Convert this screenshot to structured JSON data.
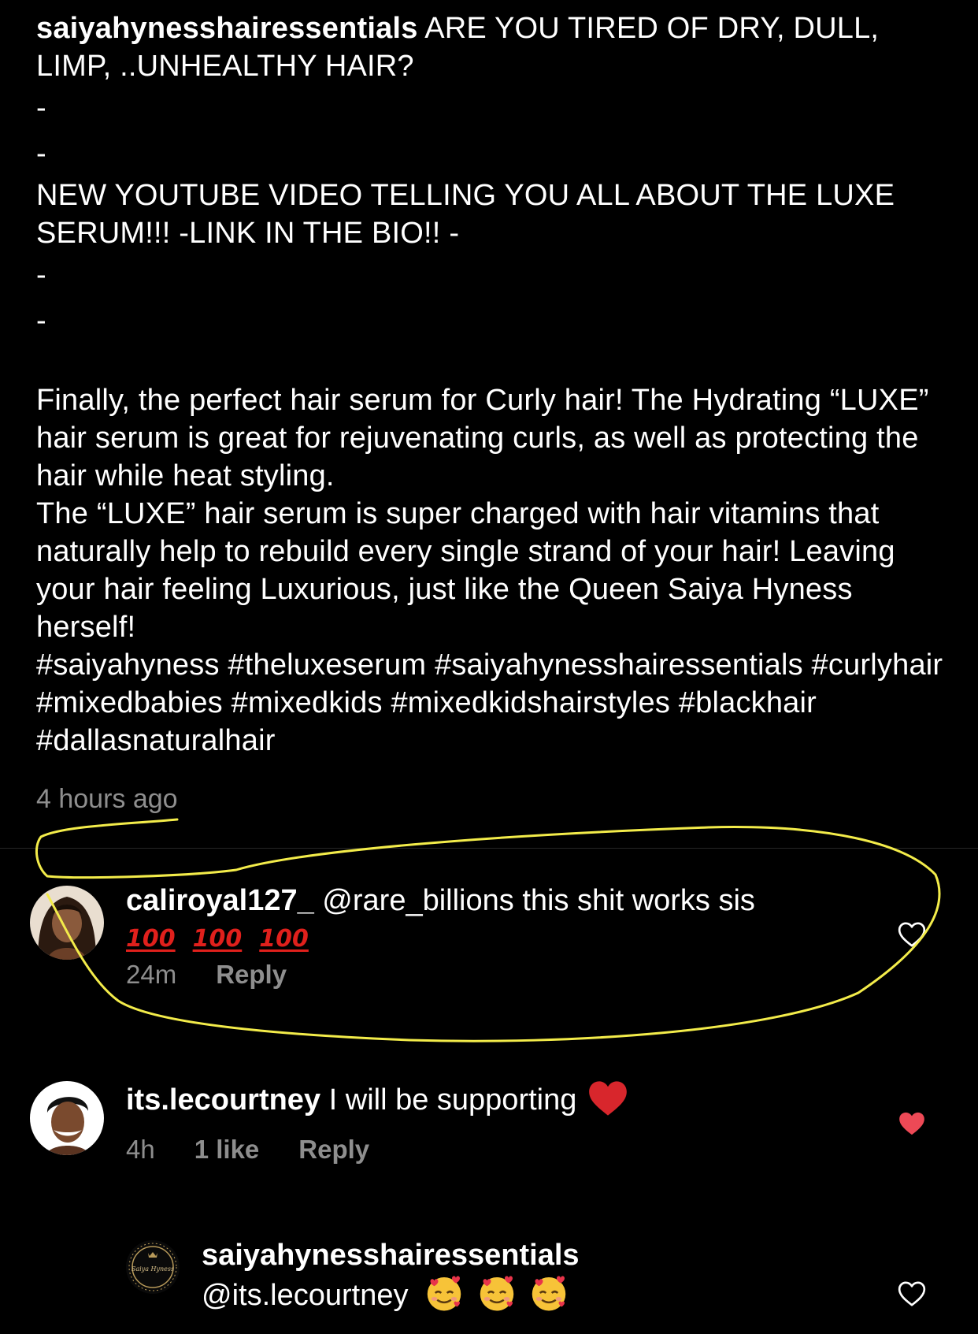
{
  "post": {
    "username": "saiyahynesshairessentials",
    "headline": " ARE YOU TIRED OF DRY, DULL, LIMP, ..UNHEALTHY HAIR?",
    "dash": "-",
    "announcement": "NEW YOUTUBE VIDEO TELLING YOU ALL ABOUT THE LUXE SERUM!!! -LINK IN THE BIO!! -",
    "paragraph1": "Finally, the perfect hair serum for Curly hair! The Hydrating “LUXE” hair serum is great for rejuvenating curls, as well as protecting the hair while heat styling.",
    "paragraph2": "The “LUXE” hair serum is super charged with hair vitamins that naturally help to rebuild every single strand of your hair! Leaving your hair feeling Luxurious, just like the Queen Saiya Hyness herself!",
    "hashtags": "#saiyahyness #theluxeserum #saiyahynesshairessentials #curlyhair #mixedbabies #mixedkids #mixedkidshairstyles #blackhair #dallasnaturalhair",
    "timestamp": "4 hours ago"
  },
  "comments": [
    {
      "username": "caliroyal127_",
      "text": " @rare_billions this shit works sis",
      "emoji": [
        "100",
        "100",
        "100"
      ],
      "time": "24m",
      "reply_label": "Reply",
      "liked": false
    },
    {
      "username": "its.lecourtney",
      "text": " I will be supporting",
      "emoji": "red-heart",
      "time": "4h",
      "likes": "1 like",
      "reply_label": "Reply",
      "liked": true
    },
    {
      "username": "saiyahynesshairessentials",
      "text": "@its.lecourtney",
      "emoji": [
        "smiling-face-with-hearts",
        "smiling-face-with-hearts",
        "smiling-face-with-hearts"
      ],
      "avatar_text": "Saiya Hyness",
      "liked": false
    }
  ],
  "colors": {
    "background": "#000000",
    "text": "#ffffff",
    "secondary": "#8e8e8e",
    "like_red": "#ed4956",
    "annotation": "#f3ec4a"
  }
}
